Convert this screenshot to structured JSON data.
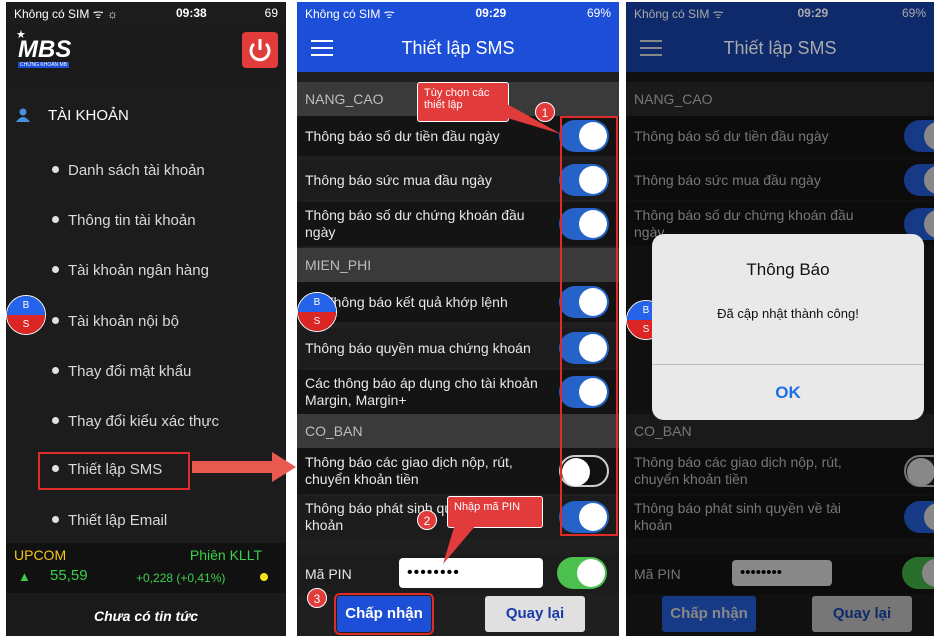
{
  "screen1": {
    "status": {
      "carrier": "Không có SIM ᯤ ☼",
      "time": "09:38",
      "battery": "69"
    },
    "logo_text": "MBS",
    "logo_sub": "CHỨNG KHOÁN MB",
    "account_header": "TÀI KHOẢN",
    "menu": [
      "Danh sách tài khoản",
      "Thông tin tài khoản",
      "Tài khoản ngân hàng",
      "Tài khoản nội bộ",
      "Thay đổi mật khẩu",
      "Thay đổi kiểu xác thực",
      "Thiết lập SMS",
      "Thiết lập Email"
    ],
    "ticker": {
      "market": "UPCOM",
      "session": "Phiên KLLT",
      "index": "55,59",
      "change": "+0,228 (+0,41%)",
      "arrow": "▲"
    },
    "news": "Chưa có tin tức",
    "bs": {
      "b": "B",
      "s": "S"
    }
  },
  "screen2": {
    "status": {
      "carrier": "Không có SIM ᯤ",
      "time": "09:29",
      "battery": "69%"
    },
    "title": "Thiết lập SMS",
    "sections": [
      "NANG_CAO",
      "MIEN_PHI",
      "CO_BAN"
    ],
    "rows": [
      {
        "label": "Thông báo số dư tiền đầu ngày",
        "on": true
      },
      {
        "label": "Thông báo sức mua đầu ngày",
        "on": true
      },
      {
        "label": "Thông báo số dư chứng khoán đầu ngày",
        "on": true
      },
      {
        "label": "Thông báo kết quả khớp lệnh",
        "on": true
      },
      {
        "label": "Thông báo quyền mua chứng khoán",
        "on": true
      },
      {
        "label": "Các  thông báo áp dụng cho tài khoản Margin, Margin+",
        "on": true
      },
      {
        "label": "Thông báo các giao dịch nộp, rút, chuyển khoản tiền",
        "on": false
      },
      {
        "label": "Thông báo phát sinh quyền về tài khoản",
        "on": true
      }
    ],
    "pin_label": "Mã PIN",
    "pin_value": "••••••••",
    "accept": "Chấp nhận",
    "back": "Quay lại",
    "callout1": "Tùy chọn các thiết lập",
    "callout2": "Nhập mã PIN",
    "num": [
      "1",
      "2",
      "3"
    ]
  },
  "screen3": {
    "alert_title": "Thông Báo",
    "alert_msg": "Đã cập nhật thành công!",
    "ok": "OK"
  },
  "colors": {
    "navbar": "#1d4ed8",
    "toggle_on": "#2563c9",
    "annotation": "#e02b2b"
  }
}
